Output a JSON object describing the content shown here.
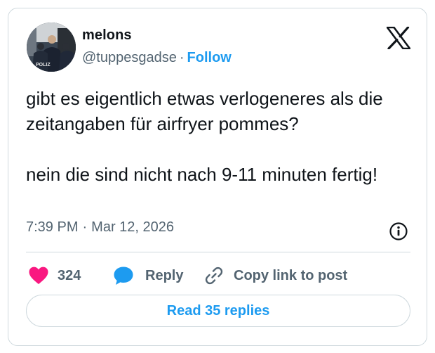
{
  "author": {
    "name": "melons",
    "handle": "@tuppesgadse",
    "separator": "·",
    "follow_label": "Follow",
    "avatar_text": "POLIZ"
  },
  "tweet": {
    "paragraphs": [
      "gibt es eigentlich etwas verlogeneres als die zeitangaben für airfryer pommes?",
      "nein die sind nicht nach 9-11 minuten fertig!"
    ],
    "time": "7:39 PM",
    "date_separator": "·",
    "date": "Mar 12, 2026"
  },
  "actions": {
    "like_count": "324",
    "reply_label": "Reply",
    "copy_label": "Copy link to post"
  },
  "footer": {
    "read_replies_label": "Read 35 replies"
  },
  "icons": {
    "brand": "x-logo-icon",
    "info": "info-icon",
    "like": "heart-icon",
    "reply": "speech-bubble-icon",
    "copy": "link-icon"
  },
  "colors": {
    "text_primary": "#0f1419",
    "text_secondary": "#536471",
    "accent": "#1d9bf0",
    "like": "#f91880",
    "border": "#cfd9de"
  }
}
